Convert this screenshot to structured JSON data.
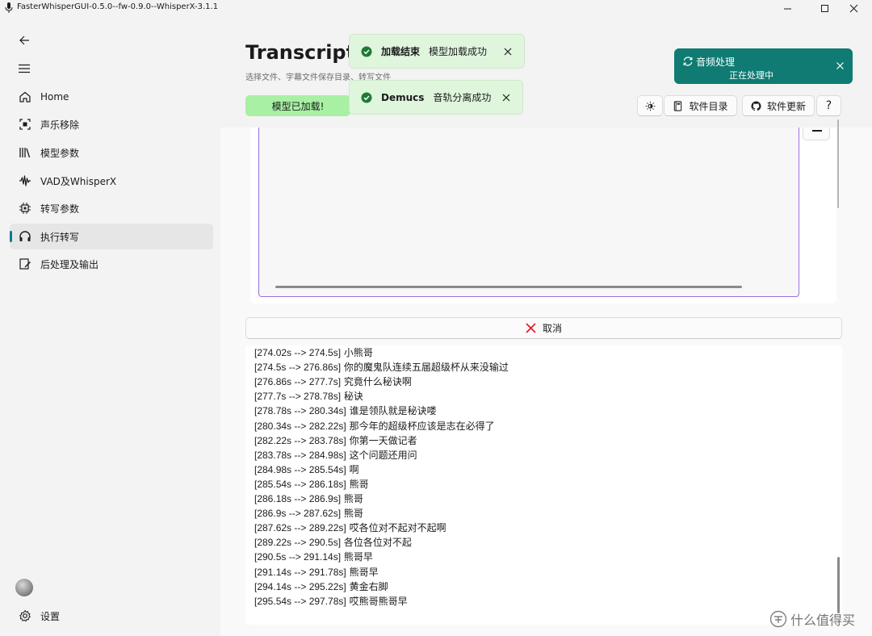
{
  "window": {
    "title": "FasterWhisperGUI-0.5.0--fw-0.9.0--WhisperX-3.1.1"
  },
  "sidebar": {
    "items": [
      {
        "label": "Home",
        "icon": "home-icon"
      },
      {
        "label": "声乐移除",
        "icon": "vocal-remove-icon"
      },
      {
        "label": "模型参数",
        "icon": "library-icon"
      },
      {
        "label": "VAD及WhisperX",
        "icon": "waveform-icon"
      },
      {
        "label": "转写参数",
        "icon": "chip-icon"
      },
      {
        "label": "执行转写",
        "icon": "headphones-icon",
        "active": true
      },
      {
        "label": "后处理及输出",
        "icon": "edit-icon"
      }
    ],
    "settings_label": "设置"
  },
  "header": {
    "title": "Transcription",
    "subtitle": "选择文件、字幕文件保存目录、转写文件",
    "model_loaded_badge": "模型已加载!",
    "toolbar": {
      "software_dir": "软件目录",
      "software_update": "软件更新",
      "help": "?"
    }
  },
  "infobars": [
    {
      "title": "加载结束",
      "message": "模型加载成功"
    },
    {
      "title": "Demucs",
      "message": "音轨分离成功"
    }
  ],
  "toast": {
    "title": "音频处理",
    "message": "正在处理中"
  },
  "cancel_label": "取消",
  "log": [
    {
      "ts": "[274.02s --> 274.5s]",
      "text": "小熊哥"
    },
    {
      "ts": "[274.5s --> 276.86s]",
      "text": "你的魔鬼队连续五届超级杯从来没输过"
    },
    {
      "ts": "[276.86s --> 277.7s]",
      "text": "究竟什么秘诀啊"
    },
    {
      "ts": "[277.7s --> 278.78s]",
      "text": "秘诀"
    },
    {
      "ts": "[278.78s --> 280.34s]",
      "text": "谁是领队就是秘诀喽"
    },
    {
      "ts": "[280.34s --> 282.22s]",
      "text": "那今年的超级杯应该是志在必得了"
    },
    {
      "ts": "[282.22s --> 283.78s]",
      "text": "你第一天做记者"
    },
    {
      "ts": "[283.78s --> 284.98s]",
      "text": "这个问题还用问"
    },
    {
      "ts": "[284.98s --> 285.54s]",
      "text": "啊"
    },
    {
      "ts": "[285.54s --> 286.18s]",
      "text": "熊哥"
    },
    {
      "ts": "[286.18s --> 286.9s]",
      "text": "熊哥"
    },
    {
      "ts": "[286.9s --> 287.62s]",
      "text": "熊哥"
    },
    {
      "ts": "[287.62s --> 289.22s]",
      "text": "哎各位对不起对不起啊"
    },
    {
      "ts": "[289.22s --> 290.5s]",
      "text": "各位各位对不起"
    },
    {
      "ts": "[290.5s --> 291.14s]",
      "text": "熊哥早"
    },
    {
      "ts": "[291.14s --> 291.78s]",
      "text": "熊哥早"
    },
    {
      "ts": "[294.14s --> 295.22s]",
      "text": "黄金右脚"
    },
    {
      "ts": "[295.54s --> 297.78s]",
      "text": "哎熊哥熊哥早"
    }
  ],
  "watermark": "什么值得买",
  "colors": {
    "accent": "#0f7b8f",
    "toast_bg": "#0f7b73",
    "infobar_bg": "#dff6dd",
    "success": "#1e7b34",
    "badge_bg": "#a7f0a4",
    "cancel_icon": "#e81123",
    "textarea_border": "#9a6fe0"
  }
}
